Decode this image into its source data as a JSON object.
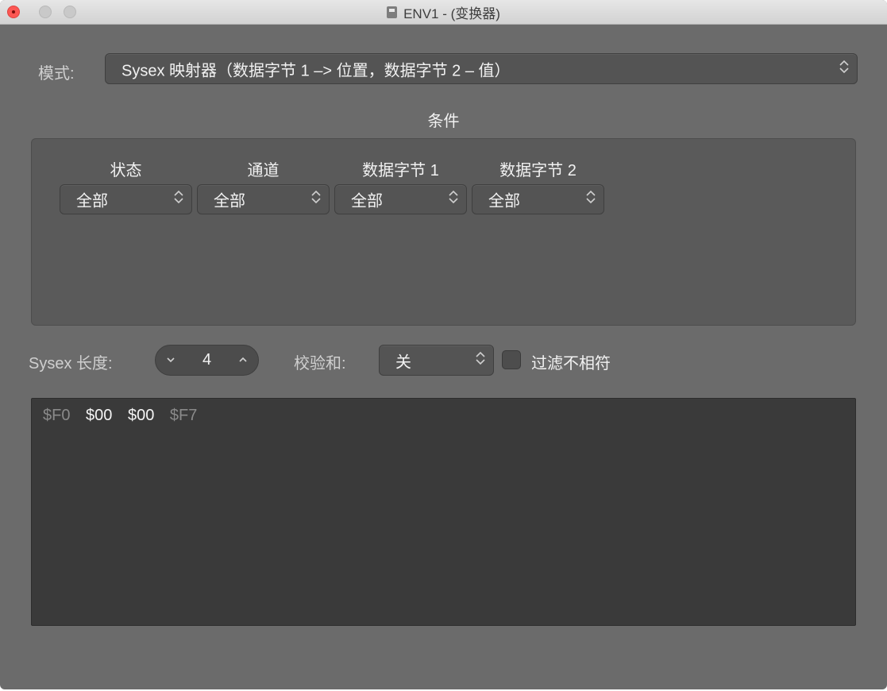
{
  "window": {
    "title": "ENV1 - (变换器)"
  },
  "mode": {
    "label": "模式:",
    "value": "Sysex 映射器（数据字节 1 –> 位置，数据字节 2 – 值）"
  },
  "conditions": {
    "heading": "条件",
    "columns": [
      {
        "header": "状态",
        "value": "全部"
      },
      {
        "header": "通道",
        "value": "全部"
      },
      {
        "header": "数据字节 1",
        "value": "全部"
      },
      {
        "header": "数据字节 2",
        "value": "全部"
      }
    ]
  },
  "sysex_length": {
    "label": "Sysex 长度:",
    "value": "4"
  },
  "checksum": {
    "label": "校验和:",
    "value": "关"
  },
  "filter_mismatch": {
    "label": "过滤不相符",
    "checked": false
  },
  "hex_bytes": [
    "$F0",
    "$00",
    "$00",
    "$F7"
  ],
  "colors": {
    "window_bg": "#6b6b6b",
    "close_button": "#fc5753",
    "hex_area_bg": "#3a3a3a"
  }
}
